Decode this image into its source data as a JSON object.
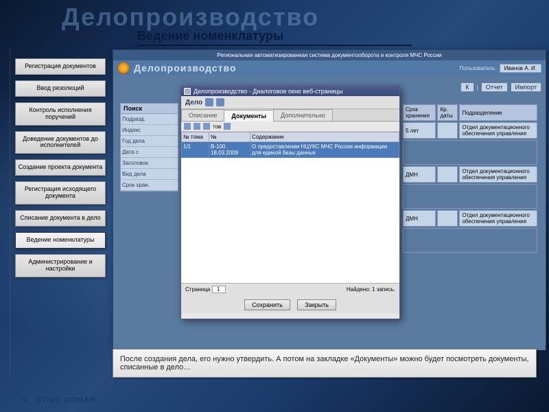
{
  "title": "Делопроизводство",
  "subtitle": "Ведение номенклатуры",
  "sidebar": {
    "items": [
      "Регистрация документов",
      "Ввод резолюций",
      "Контроль исполнения поручений",
      "Доведение документов до исполнителей",
      "Создание проекта документа",
      "Регистрация исходящего документа",
      "Списание документа в дело",
      "Ведение номенклатуры",
      "Администрирование и настройки"
    ],
    "active_index": 7
  },
  "app": {
    "header": "Региональная автоматизированная система документооборота и контроля МЧС России",
    "title2": "Делопроизводство",
    "toolbar": {
      "ok": "К",
      "report": "Отчет",
      "import": "Импорт",
      "help": "?"
    },
    "user_box": {
      "label": "Пользователь:",
      "user": "Иванов А. И."
    },
    "search": {
      "header": "Поиск",
      "fields": [
        "Подразд.",
        "Индекс",
        "Год дела",
        "Дата с",
        "Заголовок",
        "Вид дела",
        "Срок хран."
      ]
    },
    "main_table": {
      "headers": [
        "Срок хранения",
        "Кр. даты",
        "Подразделение"
      ],
      "rows": [
        {
          "srok": "5 лет",
          "kd": "",
          "podr": "Отдел документационного обеспечения управления"
        },
        {
          "srok": "ДМН",
          "kd": "",
          "podr": "Отдел документационного обеспечения управления"
        },
        {
          "srok": "ДМН",
          "kd": "",
          "podr": "Отдел документационного обеспечения управления"
        }
      ]
    }
  },
  "dialog": {
    "title": "Делопроизводство - Диалоговое окно веб-страницы",
    "toolbar_label": "Дело",
    "tabs": [
      "Описание",
      "Документы",
      "Дополнительно"
    ],
    "active_tab": 1,
    "sub_label": "тов",
    "grid": {
      "headers": [
        "№ тома",
        "№",
        "Содержание"
      ],
      "row": {
        "tom": "1/1",
        "num": "В-100",
        "date": "18.03.2009",
        "content": "О предоставлении НЦУКС МЧС России информации для единой базы данных"
      }
    },
    "footer": {
      "page_label": "Страница",
      "page": "1",
      "found_label": "Найдено: 1 запись."
    },
    "buttons": {
      "save": "Сохранить",
      "close": "Закрыть"
    }
  },
  "footer_note": "После создания дела, его нужно утвердить. А потом на закладке «Документы» можно будет посмотреть документы, списанные в дело…",
  "company": "STINS COMAN"
}
